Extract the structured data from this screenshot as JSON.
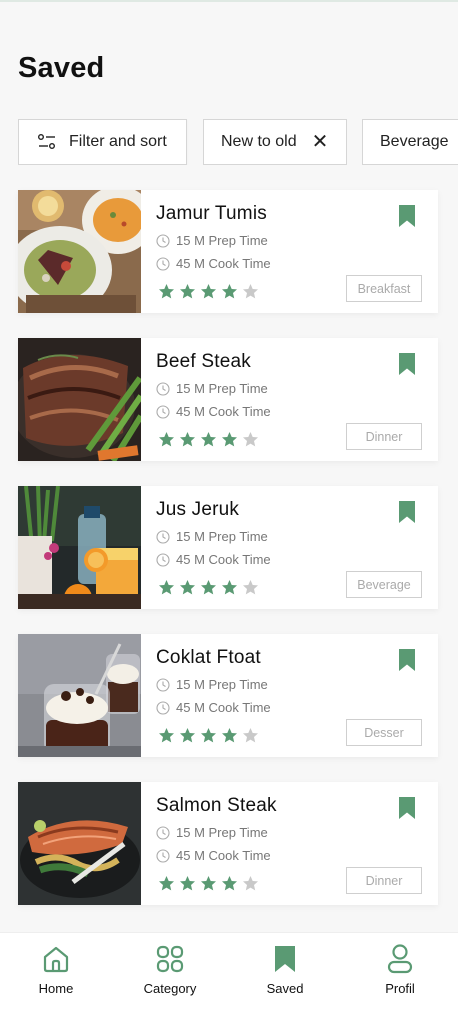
{
  "page": {
    "title": "Saved"
  },
  "filters": {
    "filter_sort_label": "Filter and sort",
    "order_label": "New to old",
    "order_clear_icon": "close-icon",
    "category_label": "Beverage"
  },
  "colors": {
    "accent": "#5a9a73",
    "star_off": "#c9c9c9",
    "text_muted": "#777777"
  },
  "recipes": [
    {
      "name": "Jamur Tumis",
      "prep": "15 M Prep Time",
      "cook": "45 M Cook Time",
      "rating": 4,
      "max_rating": 5,
      "category": "Breakfast",
      "saved": true
    },
    {
      "name": "Beef Steak",
      "prep": "15 M Prep Time",
      "cook": "45 M Cook Time",
      "rating": 4,
      "max_rating": 5,
      "category": "Dinner",
      "saved": true
    },
    {
      "name": "Jus Jeruk",
      "prep": "15 M Prep Time",
      "cook": "45 M Cook Time",
      "rating": 4,
      "max_rating": 5,
      "category": "Beverage",
      "saved": true
    },
    {
      "name": "Coklat Ftoat",
      "prep": "15 M Prep Time",
      "cook": "45 M Cook Time",
      "rating": 4,
      "max_rating": 5,
      "category": "Desser",
      "saved": true
    },
    {
      "name": "Salmon Steak",
      "prep": "15 M Prep Time",
      "cook": "45 M Cook Time",
      "rating": 4,
      "max_rating": 5,
      "category": "Dinner",
      "saved": true
    }
  ],
  "nav": [
    {
      "label": "Home",
      "icon": "home-icon",
      "active": false
    },
    {
      "label": "Category",
      "icon": "category-grid-icon",
      "active": false
    },
    {
      "label": "Saved",
      "icon": "bookmark-icon",
      "active": true
    },
    {
      "label": "Profil",
      "icon": "profile-icon",
      "active": false
    }
  ]
}
